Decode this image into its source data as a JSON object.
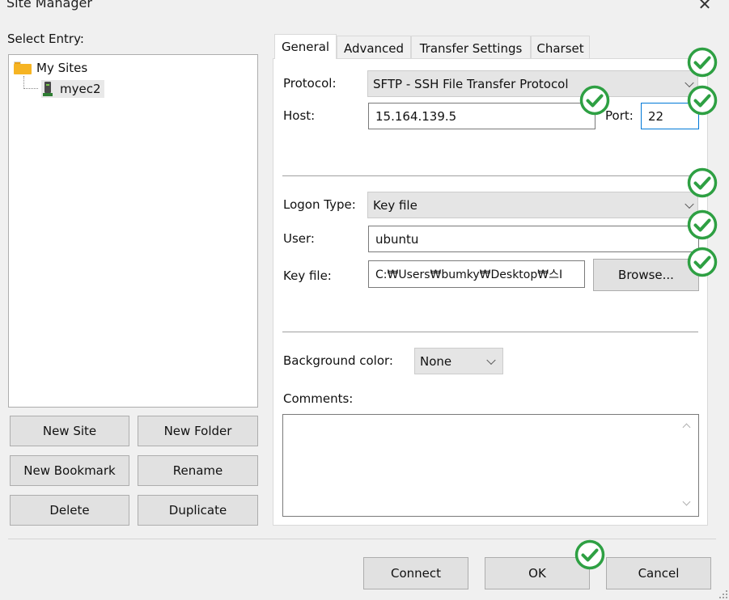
{
  "window": {
    "title": "Site Manager"
  },
  "left": {
    "select_entry_label": "Select Entry:",
    "tree": {
      "root": "My Sites",
      "child": "myec2"
    },
    "buttons": {
      "new_site": "New Site",
      "new_folder": "New Folder",
      "new_bookmark": "New Bookmark",
      "rename": "Rename",
      "delete": "Delete",
      "duplicate": "Duplicate"
    }
  },
  "tabs": [
    "General",
    "Advanced",
    "Transfer Settings",
    "Charset"
  ],
  "general": {
    "protocol_label": "Protocol:",
    "protocol_value": "SFTP - SSH File Transfer Protocol",
    "host_label": "Host:",
    "host_value": "15.164.139.5",
    "port_label": "Port:",
    "port_value": "22",
    "logon_type_label": "Logon Type:",
    "logon_type_value": "Key file",
    "user_label": "User:",
    "user_value": "ubuntu",
    "key_file_label": "Key file:",
    "key_file_value": "C:₩Users₩bumky₩Desktop₩스I",
    "browse_label": "Browse...",
    "bg_color_label": "Background color:",
    "bg_color_value": "None",
    "comments_label": "Comments:"
  },
  "footer": {
    "connect": "Connect",
    "ok": "OK",
    "cancel": "Cancel"
  },
  "colors": {
    "check_green": "#2ea043",
    "focus_blue": "#0078d7",
    "folder": "#f6b423"
  },
  "icons": {
    "close": "close-icon",
    "check": "check-circle-icon",
    "folder": "folder-icon",
    "server": "server-icon"
  }
}
